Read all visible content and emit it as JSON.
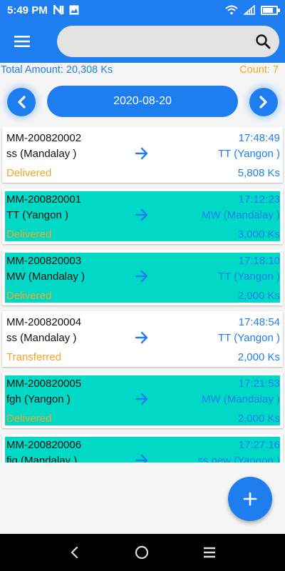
{
  "status_bar": {
    "time": "5:49 PM",
    "left_icons": [
      "n-notification-icon",
      "image-notification-icon"
    ],
    "right_icons": [
      "wifi-icon",
      "signal-icon",
      "battery-icon"
    ]
  },
  "app_bar": {
    "menu_icon": "hamburger-menu-icon",
    "search_value": "",
    "search_icon": "search-icon"
  },
  "summary": {
    "total_amount": "Total Amount: 20,308 Ks",
    "count": "Count: 7"
  },
  "date_nav": {
    "date": "2020-08-20",
    "prev_icon": "chevron-left-icon",
    "next_icon": "chevron-right-icon"
  },
  "orders": [
    {
      "id": "MM-200820002",
      "time": "17:48:49",
      "from": "ss (Mandalay )",
      "to": "TT (Yangon )",
      "status": "Delivered",
      "amount": "5,808 Ks",
      "highlighted": false
    },
    {
      "id": "MM-200820001",
      "time": "17:12:23",
      "from": "TT (Yangon )",
      "to": "MW (Mandalay )",
      "status": "Delivered",
      "amount": "3,000 Ks",
      "highlighted": true
    },
    {
      "id": "MM-200820003",
      "time": "17:18:10",
      "from": "MW (Mandalay )",
      "to": "TT (Yangon )",
      "status": "Delivered",
      "amount": "2,000 Ks",
      "highlighted": true
    },
    {
      "id": "MM-200820004",
      "time": "17:48:54",
      "from": "ss (Mandalay )",
      "to": "TT (Yangon )",
      "status": "Transferred",
      "amount": "2,000 Ks",
      "highlighted": false
    },
    {
      "id": "MM-200820005",
      "time": "17:21:53",
      "from": "fgh (Yangon )",
      "to": "MW (Mandalay )",
      "status": "Delivered",
      "amount": "2,000 Ks",
      "highlighted": true
    },
    {
      "id": "MM-200820006",
      "time": "17:27:16",
      "from": "fig (Mandalay )",
      "to": "ss new (Yangon )",
      "status": "",
      "amount": "",
      "highlighted": true
    }
  ],
  "fab": {
    "icon": "plus-icon",
    "label": "+"
  },
  "nav_bar": {
    "icons": [
      "back-icon",
      "home-icon",
      "recents-icon"
    ]
  },
  "colors": {
    "primary": "#1e7ef0",
    "highlight": "#00d9c6",
    "status": "#f5a623"
  }
}
